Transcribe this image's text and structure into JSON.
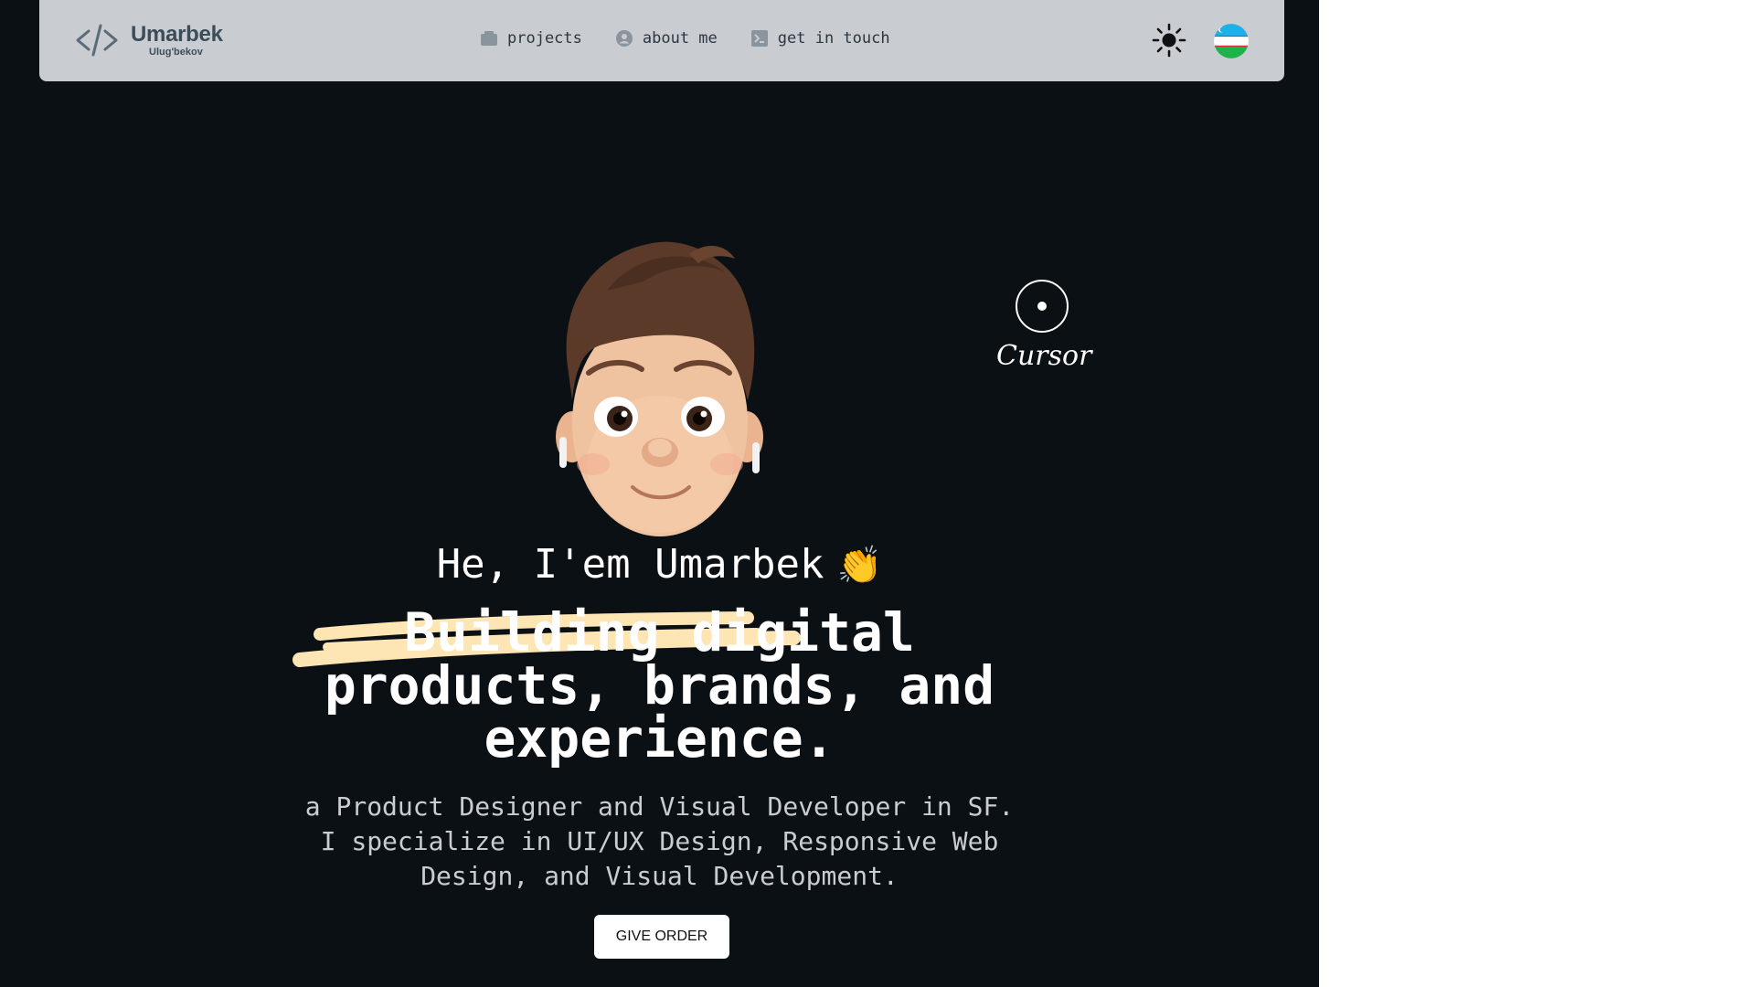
{
  "colors": {
    "page_bg": "#0b1015",
    "navbar_bg": "#c9ccd0",
    "highlight": "#fde5b4",
    "text_primary": "#ffffff",
    "text_muted": "#c9cdd2"
  },
  "header": {
    "logo": {
      "icon": "code-brackets-icon",
      "name": "Umarbek",
      "sub": "Ulug'bekov"
    },
    "nav": [
      {
        "label": "projects",
        "icon": "folder-icon"
      },
      {
        "label": "about me",
        "icon": "user-circle-icon"
      },
      {
        "label": "get in touch",
        "icon": "terminal-icon"
      }
    ],
    "theme_toggle_icon": "sun-icon",
    "language_flag_icon": "uzbekistan-flag-icon"
  },
  "cursor": {
    "label": "Cursor"
  },
  "hero": {
    "greeting": "He, I'em Umarbek",
    "greeting_emoji": "👏",
    "headline": [
      "Building digital",
      "products, brands, and",
      "experience."
    ],
    "description": [
      "a Product Designer and Visual Developer in SF.",
      "I specialize in UI/UX Design, Responsive Web",
      "Design, and Visual Development."
    ],
    "cta_label": "GIVE ORDER"
  }
}
